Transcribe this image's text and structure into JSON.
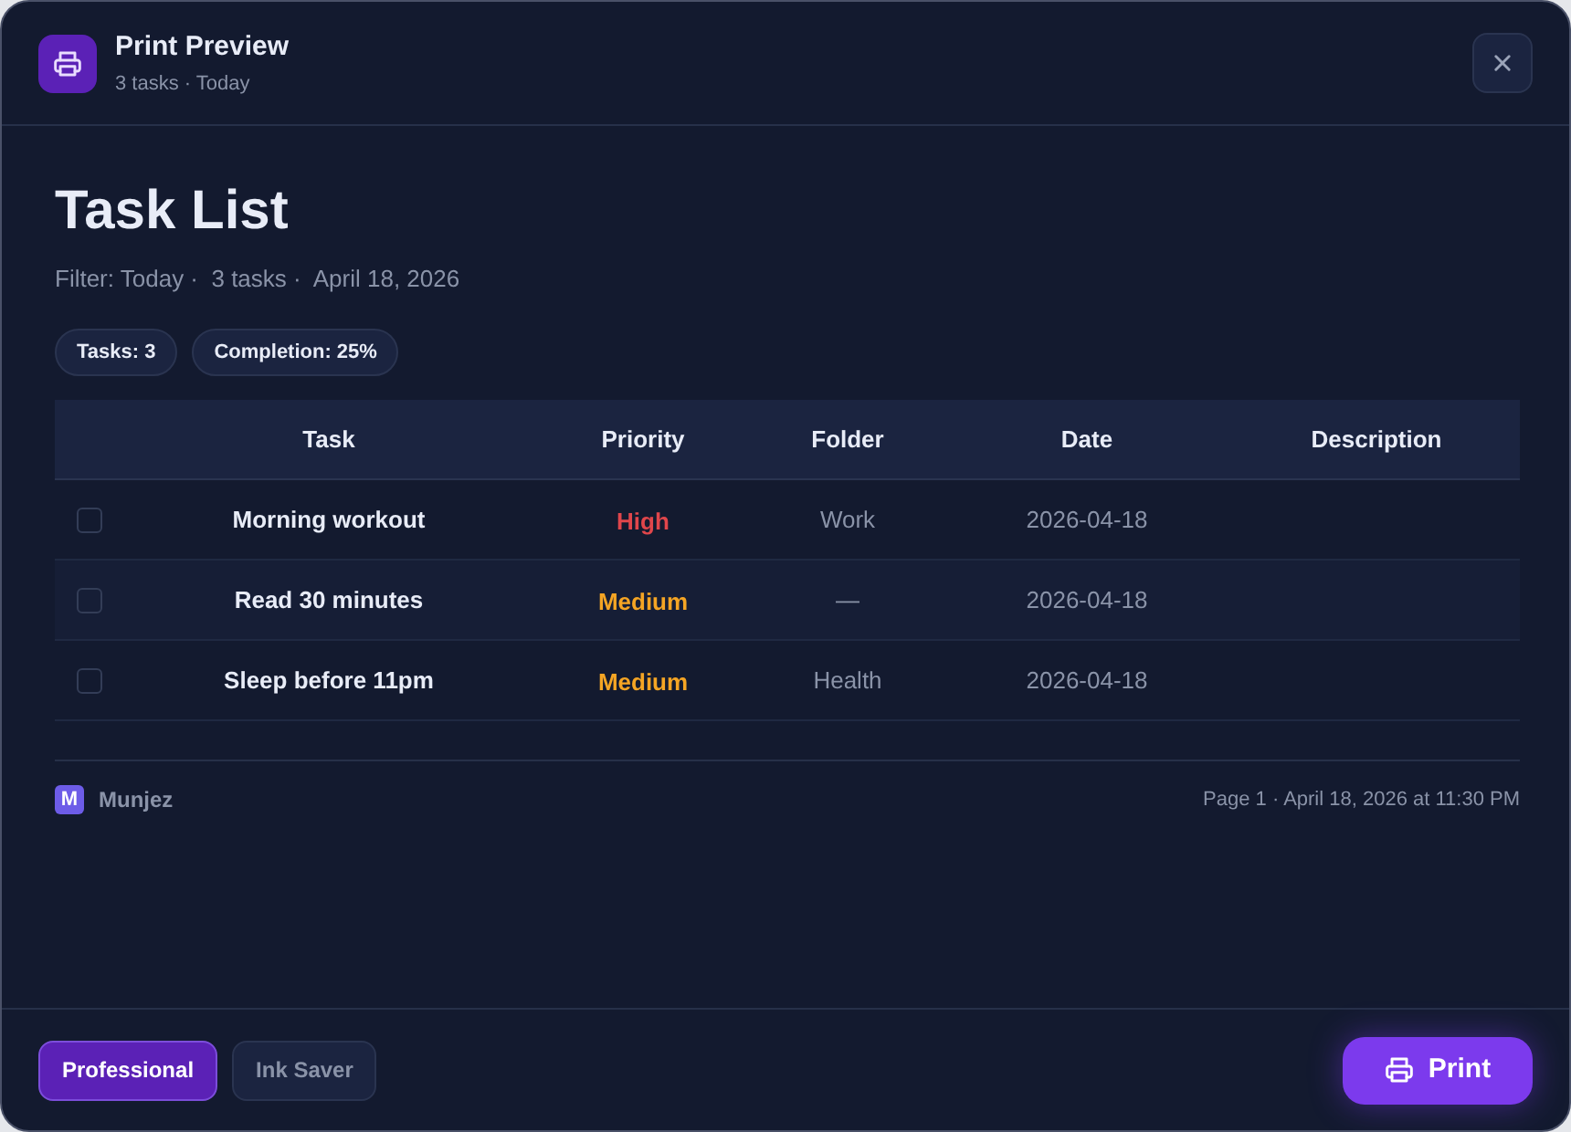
{
  "dialog": {
    "title": "Print Preview",
    "subtitle": "3 tasks · Today"
  },
  "document": {
    "title": "Task List",
    "meta": "Filter: Today ·  3 tasks ·  April 18, 2026",
    "stats": [
      "Tasks: 3",
      "Completion: 25%"
    ]
  },
  "table": {
    "columns": [
      "Task",
      "Priority",
      "Folder",
      "Date",
      "Description"
    ],
    "rows": [
      {
        "checked": false,
        "task": "Morning workout",
        "priority": "High",
        "color": "#e0464b",
        "folder": "Work",
        "date": "2026-04-18"
      },
      {
        "checked": false,
        "task": "Read 30 minutes",
        "priority": "Medium",
        "color": "#f5a524",
        "folder": "—",
        "date": "2026-04-18"
      },
      {
        "checked": false,
        "task": "Sleep before 11pm",
        "priority": "Medium",
        "color": "#f5a524",
        "folder": "Health",
        "date": "2026-04-18"
      }
    ]
  },
  "footer": {
    "brand_letter": "M",
    "brand": "Munjez",
    "page_info": "Page 1 · April 18, 2026 at 11:30 PM"
  },
  "themes": [
    {
      "label": "Professional",
      "selected": true
    },
    {
      "label": "Ink Saver",
      "selected": false
    }
  ],
  "print_button": "Print"
}
